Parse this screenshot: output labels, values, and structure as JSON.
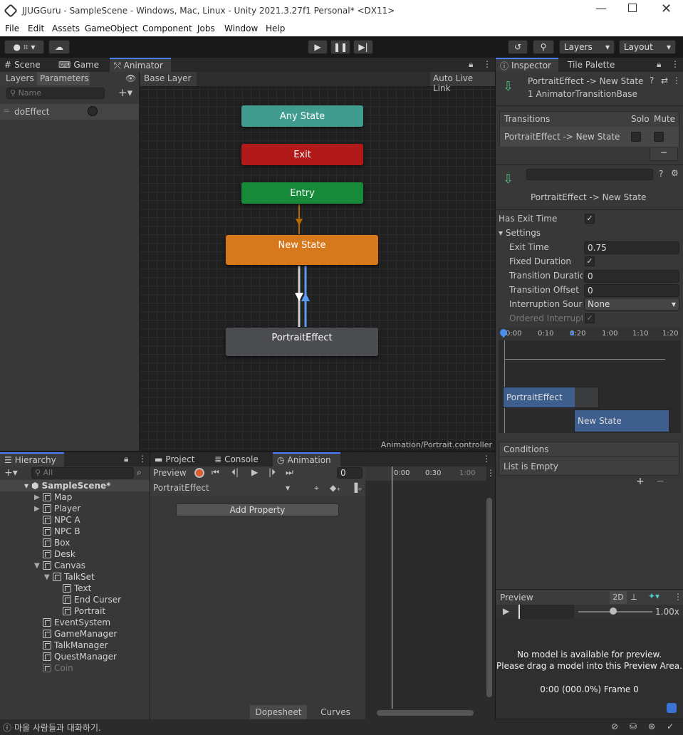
{
  "window": {
    "title": "JJUGGuru - SampleScene - Windows, Mac, Linux - Unity 2021.3.27f1 Personal* <DX11>"
  },
  "menu": [
    "File",
    "Edit",
    "Assets",
    "GameObject",
    "Component",
    "Jobs",
    "Window",
    "Help"
  ],
  "toolbar": {
    "layers": "Layers",
    "layout": "Layout"
  },
  "animator": {
    "tabs": [
      "Scene",
      "Game",
      "Animator"
    ],
    "subtabs": [
      "Layers",
      "Parameters"
    ],
    "search_placeholder": "Name",
    "breadcrumb": "Base Layer",
    "auto_live_link": "Auto Live Link",
    "parameter": "doEffect",
    "nodes": {
      "any": "Any State",
      "exit": "Exit",
      "entry": "Entry",
      "new_state": "New State",
      "portrait": "PortraitEffect"
    },
    "path": "Animation/Portrait.controller"
  },
  "inspector": {
    "tabs": [
      "Inspector",
      "Tile Palette"
    ],
    "header_title": "PortraitEffect -> New State",
    "header_sub": "1 AnimatorTransitionBase",
    "transitions_label": "Transitions",
    "solo": "Solo",
    "mute": "Mute",
    "transition_row": "PortraitEffect -> New State",
    "transition_title": "PortraitEffect -> New State",
    "has_exit_time": "Has Exit Time",
    "settings": "Settings",
    "exit_time_label": "Exit Time",
    "exit_time": "0.75",
    "fixed_duration": "Fixed Duration",
    "transition_duration_label": "Transition Duration",
    "transition_duration": "0",
    "transition_offset_label": "Transition Offset",
    "transition_offset": "0",
    "interruption_label": "Interruption Source",
    "interruption": "None",
    "ordered_label": "Ordered Interruption",
    "timeline_ticks": [
      "0:00",
      "0:10",
      "0:20",
      "1:00",
      "1:10",
      "1:20"
    ],
    "bar_from": "PortraitEffect",
    "bar_to": "New State",
    "conditions": "Conditions",
    "conditions_empty": "List is Empty",
    "preview": "Preview",
    "preview_2d": "2D",
    "speed": "1.00x",
    "no_model_1": "No model is available for preview.",
    "no_model_2": "Please drag a model into this Preview Area.",
    "frame": "0:00 (000.0%) Frame 0"
  },
  "hierarchy": {
    "tab": "Hierarchy",
    "search_placeholder": "All",
    "scene": "SampleScene*",
    "items": [
      {
        "name": "Map",
        "depth": 1,
        "arrow": true
      },
      {
        "name": "Player",
        "depth": 1,
        "arrow": true
      },
      {
        "name": "NPC A",
        "depth": 1
      },
      {
        "name": "NPC B",
        "depth": 1
      },
      {
        "name": "Box",
        "depth": 1
      },
      {
        "name": "Desk",
        "depth": 1
      },
      {
        "name": "Canvas",
        "depth": 1,
        "expanded": true
      },
      {
        "name": "TalkSet",
        "depth": 2,
        "expanded": true
      },
      {
        "name": "Text",
        "depth": 3
      },
      {
        "name": "End Curser",
        "depth": 3
      },
      {
        "name": "Portrait",
        "depth": 3
      },
      {
        "name": "EventSystem",
        "depth": 1
      },
      {
        "name": "GameManager",
        "depth": 1
      },
      {
        "name": "TalkManager",
        "depth": 1
      },
      {
        "name": "QuestManager",
        "depth": 1
      },
      {
        "name": "Coin",
        "depth": 1,
        "disabled": true
      }
    ]
  },
  "animation": {
    "tabs": [
      "Project",
      "Console",
      "Animation"
    ],
    "preview": "Preview",
    "frame": "0",
    "clip": "PortraitEffect",
    "add_property": "Add Property",
    "ticks": [
      "0:00",
      "0:30",
      "1:00"
    ],
    "dopesheet": "Dopesheet",
    "curves": "Curves"
  },
  "status": {
    "message": "마을 사람들과 대화하기."
  }
}
